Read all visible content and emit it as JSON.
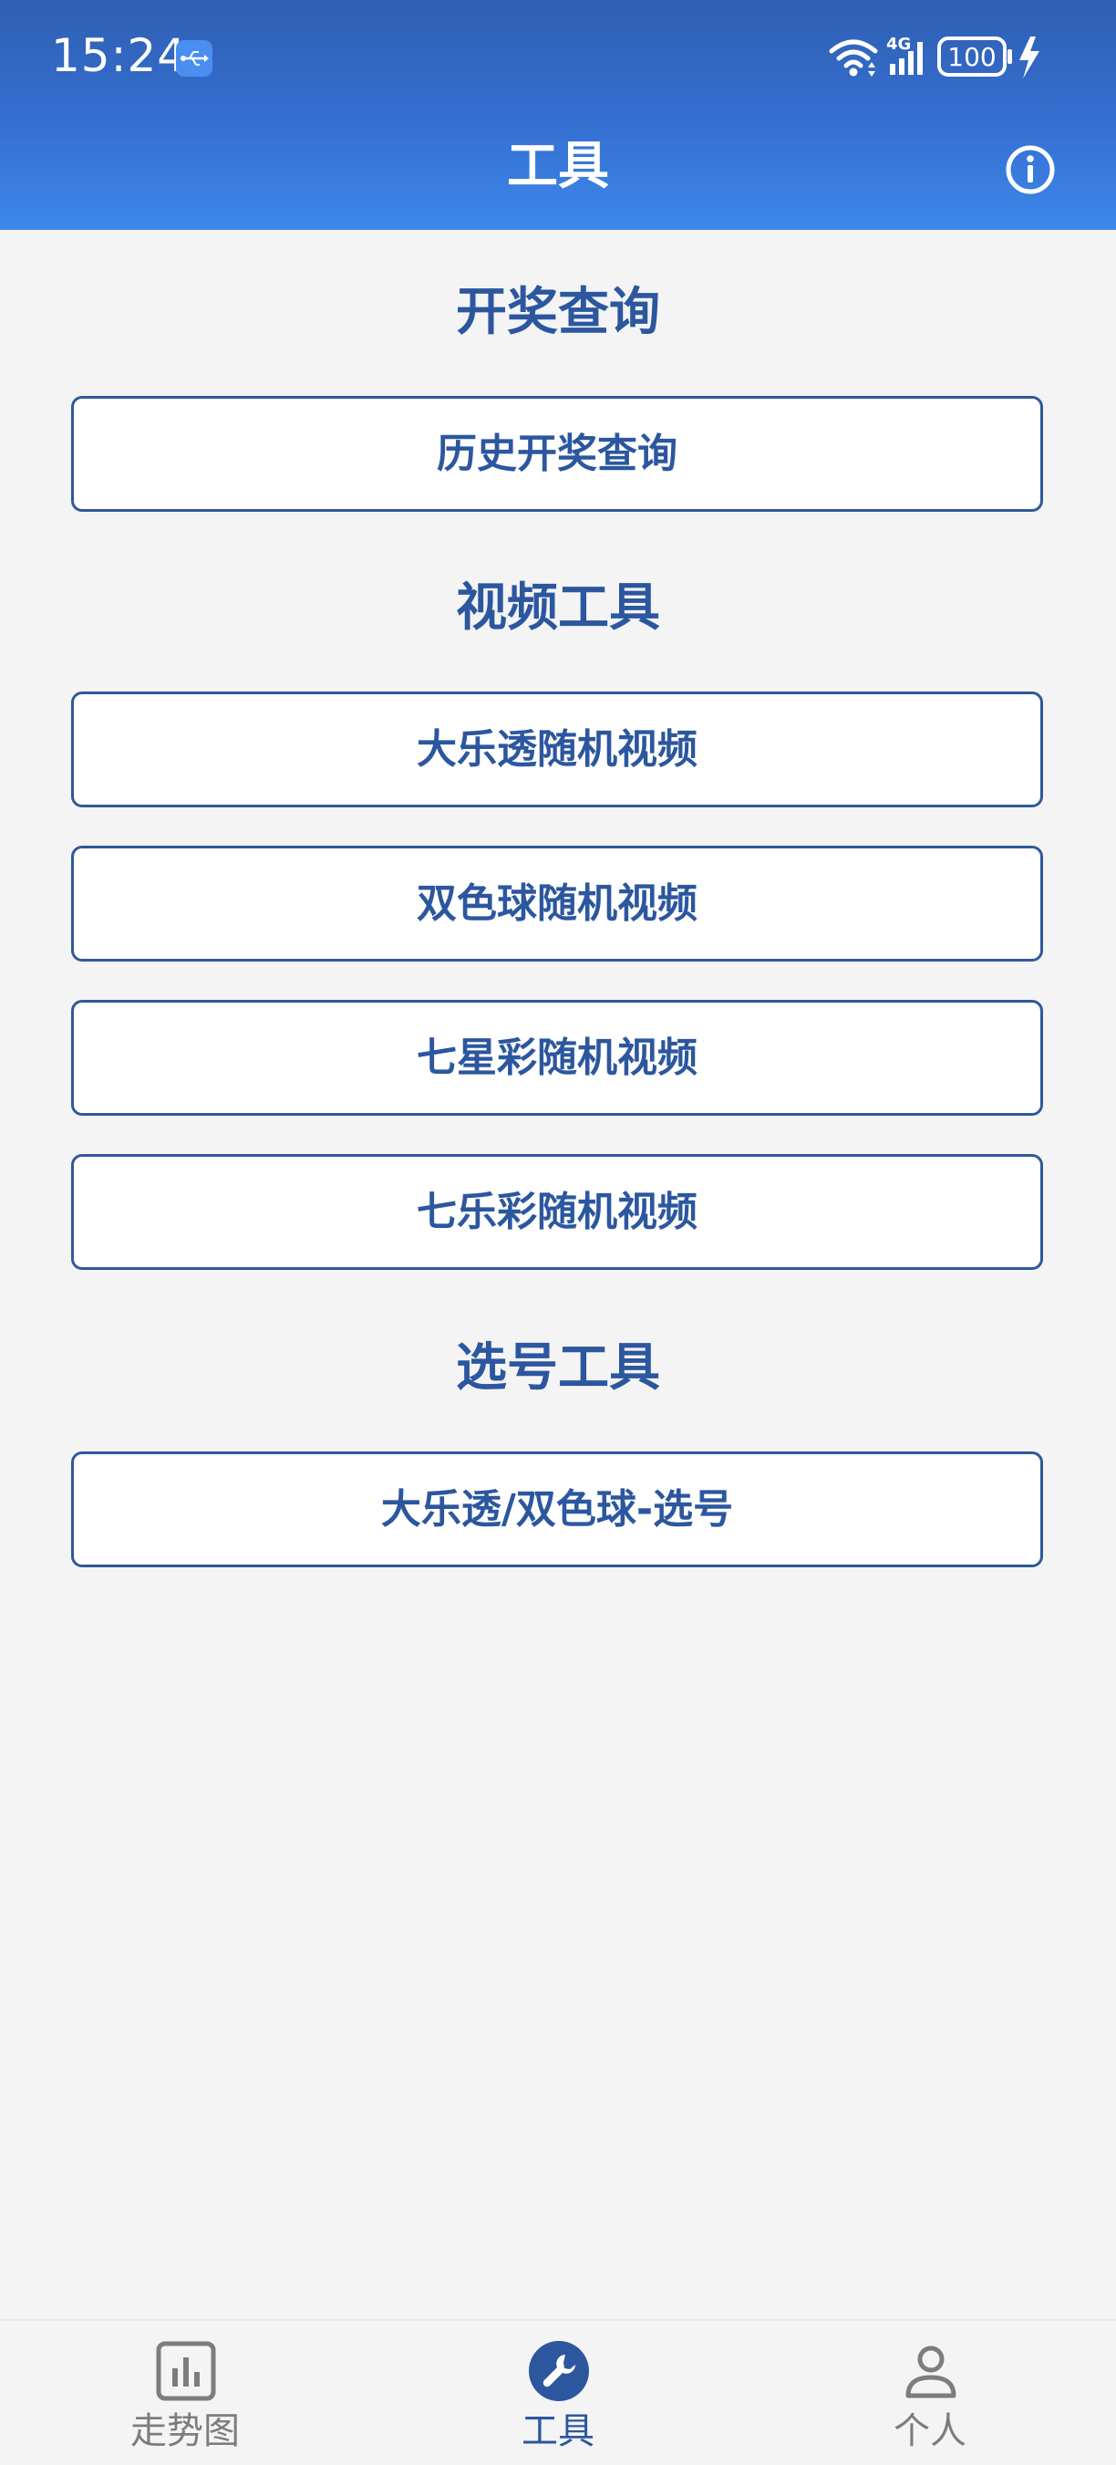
{
  "status_bar": {
    "time": "15:24",
    "network": "4G",
    "battery": "100"
  },
  "header": {
    "title": "工具"
  },
  "sections": [
    {
      "title": "开奖查询",
      "buttons": [
        "历史开奖查询"
      ]
    },
    {
      "title": "视频工具",
      "buttons": [
        "大乐透随机视频",
        "双色球随机视频",
        "七星彩随机视频",
        "七乐彩随机视频"
      ]
    },
    {
      "title": "选号工具",
      "buttons": [
        "大乐透/双色球-选号"
      ]
    }
  ],
  "bottom_nav": {
    "items": [
      {
        "label": "走势图",
        "icon": "bar-chart-icon",
        "active": false
      },
      {
        "label": "工具",
        "icon": "wrench-icon",
        "active": true
      },
      {
        "label": "个人",
        "icon": "person-icon",
        "active": false
      }
    ]
  },
  "colors": {
    "header_top": "#2f5fb2",
    "header_bottom": "#3d88ea",
    "accent": "#2c579f",
    "background": "#f4f4f5",
    "inactive": "#7d7d7d"
  }
}
